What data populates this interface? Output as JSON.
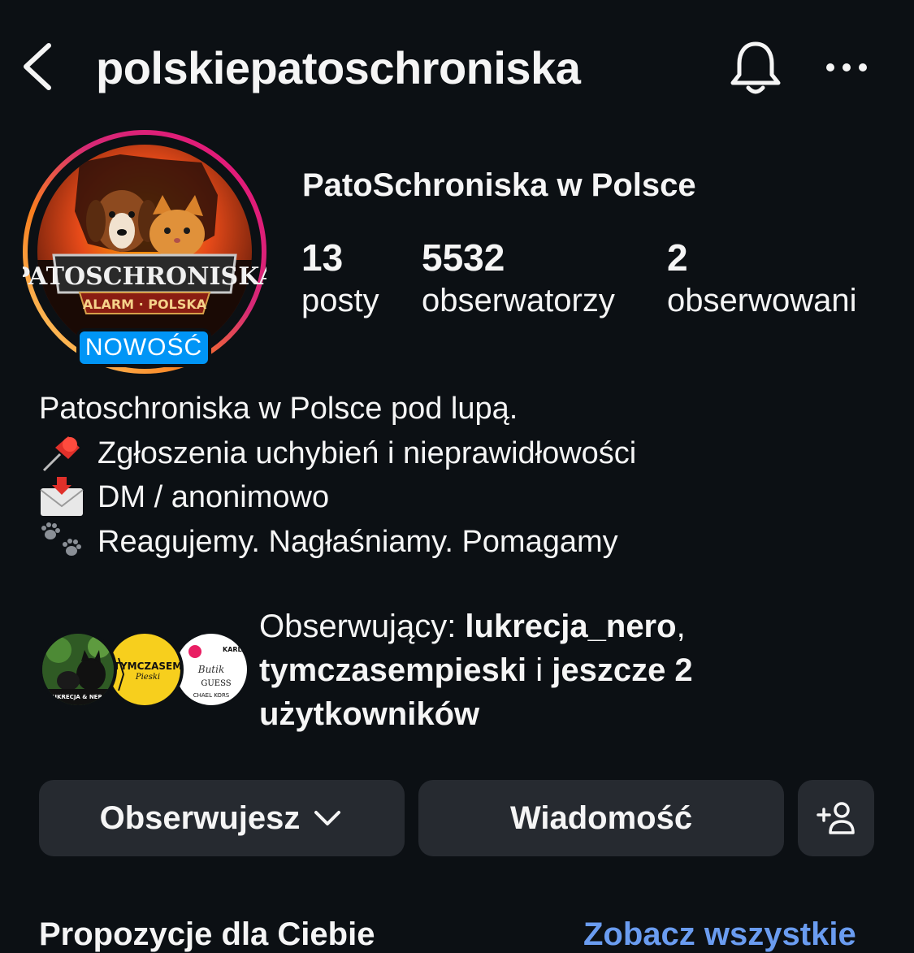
{
  "header": {
    "username": "polskiepatoschroniska",
    "back_icon": "chevron-left-icon",
    "bell_icon": "bell-icon",
    "more_icon": "more-horizontal-icon"
  },
  "profile": {
    "display_name": "PatoSchroniska w Polsce",
    "avatar_text_main": "PATOSCHRONISKA",
    "avatar_text_sub": "ALARM · POLSKA",
    "badge": "NOWOŚĆ",
    "stats": [
      {
        "value": "13",
        "label": "posty"
      },
      {
        "value": "5532",
        "label": "obserwatorzy"
      },
      {
        "value": "2",
        "label": "obserwowani"
      }
    ]
  },
  "bio": {
    "line1": "Patoschroniska w Polsce pod lupą.",
    "line2": "Zgłoszenia uchybień i nieprawidłowości",
    "line3": "DM / anonimowo",
    "line4": "Reagujemy. Nagłaśniamy. Pomagamy",
    "emoji2": "pushpin-icon",
    "emoji3": "envelope-arrow-icon",
    "emoji4": "paw-prints-icon"
  },
  "followers": {
    "prefix": "Obserwujący: ",
    "user1": "lukrecja_nero",
    "sep": ",",
    "user2": "tymczasempieski",
    "middle": " i ",
    "rest": "jeszcze 2 użytkowników",
    "avatar1_text": "LUKRECJA & NERO",
    "avatar2_text": "TYMCZASEM",
    "avatar2_sub": "Pieski",
    "avatar3_text": "Butik",
    "avatar3_sub1": "GUESS",
    "avatar3_sub2": "CHAEL KORS",
    "avatar3_sub3": "KARL"
  },
  "actions": {
    "follow_label": "Obserwujesz",
    "message_label": "Wiadomość",
    "add_user_icon": "add-user-icon"
  },
  "suggestions": {
    "title": "Propozycje dla Ciebie",
    "see_all": "Zobacz wszystkie"
  },
  "colors": {
    "background": "#0c1014",
    "button": "#262a30",
    "badge": "#0095f6",
    "link": "#6a9cf0"
  }
}
